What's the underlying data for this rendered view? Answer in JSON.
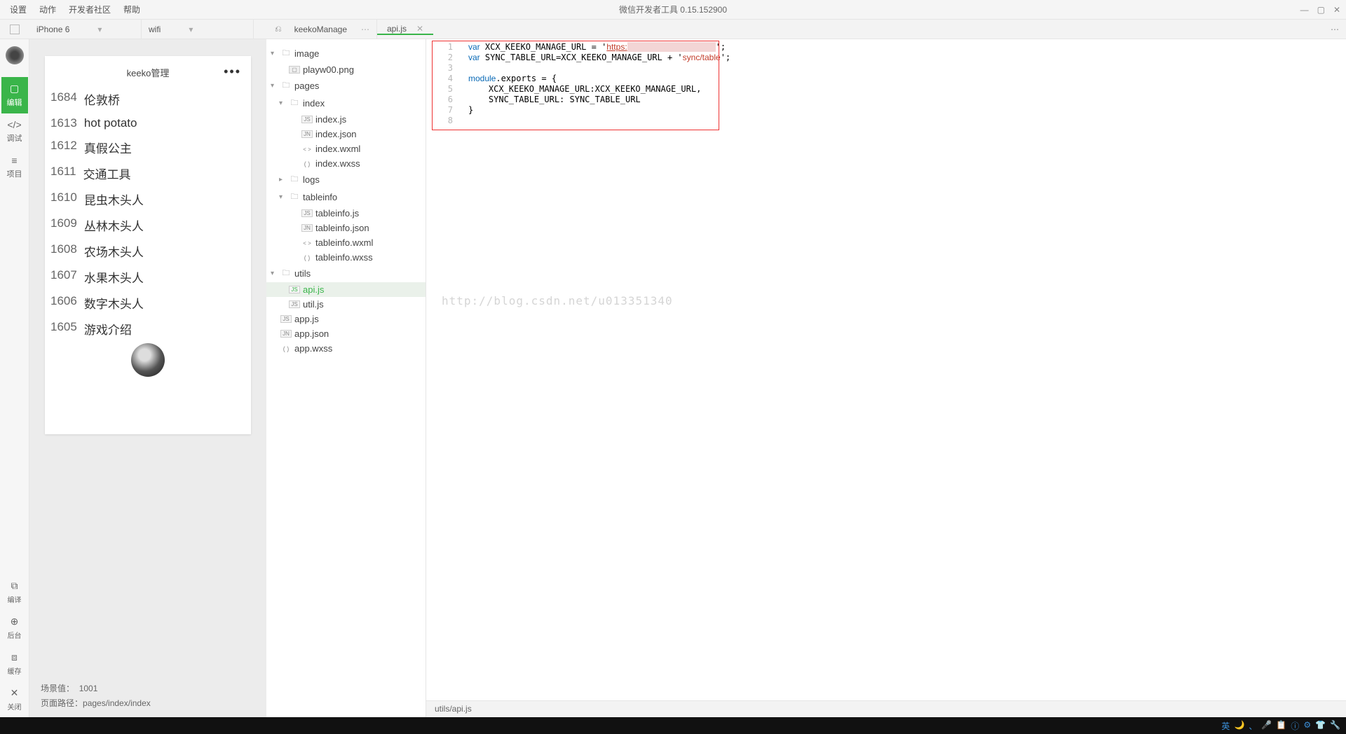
{
  "topbar": {
    "menus": [
      "设置",
      "动作",
      "开发者社区",
      "帮助"
    ],
    "title": "微信开发者工具 0.15.152900"
  },
  "secondbar": {
    "device": "iPhone 6",
    "network": "wifi",
    "project_name": "keekoManage",
    "open_tab": "api.js"
  },
  "leftside": {
    "items": [
      {
        "icon": "▢",
        "label": "编辑",
        "active": true
      },
      {
        "icon": "</>",
        "label": "调试"
      },
      {
        "icon": "≡",
        "label": "项目"
      }
    ],
    "bottom": [
      {
        "icon": "⧉",
        "label": "编译"
      },
      {
        "icon": "⊕",
        "label": "后台"
      },
      {
        "icon": "⧈",
        "label": "缓存"
      },
      {
        "icon": "✕",
        "label": "关闭"
      }
    ]
  },
  "sim": {
    "title": "keeko管理",
    "rows": [
      {
        "id": "1684",
        "text": "伦敦桥"
      },
      {
        "id": "1613",
        "text": "hot potato"
      },
      {
        "id": "1612",
        "text": "真假公主"
      },
      {
        "id": "1611",
        "text": "交通工具"
      },
      {
        "id": "1610",
        "text": "昆虫木头人"
      },
      {
        "id": "1609",
        "text": "丛林木头人"
      },
      {
        "id": "1608",
        "text": "农场木头人"
      },
      {
        "id": "1607",
        "text": "水果木头人"
      },
      {
        "id": "1606",
        "text": "数字木头人"
      },
      {
        "id": "1605",
        "text": "游戏介绍"
      }
    ],
    "status": {
      "scene_label": "场景值：",
      "scene_value": "1001",
      "path_label": "页面路径：",
      "path_value": "pages/index/index"
    }
  },
  "tree": [
    {
      "name": "image",
      "type": "folder",
      "indent": 0,
      "expanded": true
    },
    {
      "name": "playw00.png",
      "type": "png",
      "indent": 1
    },
    {
      "name": "pages",
      "type": "folder",
      "indent": 0,
      "expanded": true
    },
    {
      "name": "index",
      "type": "folder",
      "indent": 1,
      "expanded": true
    },
    {
      "name": "index.js",
      "type": "js",
      "indent": 2
    },
    {
      "name": "index.json",
      "type": "json",
      "indent": 2
    },
    {
      "name": "index.wxml",
      "type": "wxml",
      "indent": 2
    },
    {
      "name": "index.wxss",
      "type": "wxss",
      "indent": 2
    },
    {
      "name": "logs",
      "type": "folder",
      "indent": 1,
      "expanded": false
    },
    {
      "name": "tableinfo",
      "type": "folder",
      "indent": 1,
      "expanded": true
    },
    {
      "name": "tableinfo.js",
      "type": "js",
      "indent": 2
    },
    {
      "name": "tableinfo.json",
      "type": "json",
      "indent": 2
    },
    {
      "name": "tableinfo.wxml",
      "type": "wxml",
      "indent": 2
    },
    {
      "name": "tableinfo.wxss",
      "type": "wxss",
      "indent": 2
    },
    {
      "name": "utils",
      "type": "folder",
      "indent": 0,
      "expanded": true
    },
    {
      "name": "api.js",
      "type": "js",
      "indent": 1,
      "selected": true
    },
    {
      "name": "util.js",
      "type": "js",
      "indent": 1
    },
    {
      "name": "app.js",
      "type": "js",
      "indent": 0,
      "leaf": true
    },
    {
      "name": "app.json",
      "type": "json",
      "indent": 0,
      "leaf": true
    },
    {
      "name": "app.wxss",
      "type": "wxss",
      "indent": 0,
      "leaf": true
    }
  ],
  "editor": {
    "lines": [
      1,
      2,
      3,
      4,
      5,
      6,
      7,
      8
    ],
    "code_html": "<span class='kw'>var</span> XCX_KEEKO_MANAGE_URL = '<span class='str-ul'>https:</span><span class='mask'>xxxxxxxxxxxxxxxxxxxxx</span>';\n<span class='kw'>var</span> SYNC_TABLE_URL=XCX_KEEKO_MANAGE_URL + '<span class='str'>sync/table</span>';\n\n<span class='kw'>module</span>.exports = {\n    XCX_KEEKO_MANAGE_URL:XCX_KEEKO_MANAGE_URL,\n    SYNC_TABLE_URL: SYNC_TABLE_URL\n}\n",
    "watermark": "http://blog.csdn.net/u013351340",
    "statusbar": "utils/api.js"
  },
  "tray": [
    "英",
    "🌙",
    "、",
    "🎤",
    "📋",
    "ⓘ",
    "⚙",
    "👕",
    "🔧"
  ]
}
